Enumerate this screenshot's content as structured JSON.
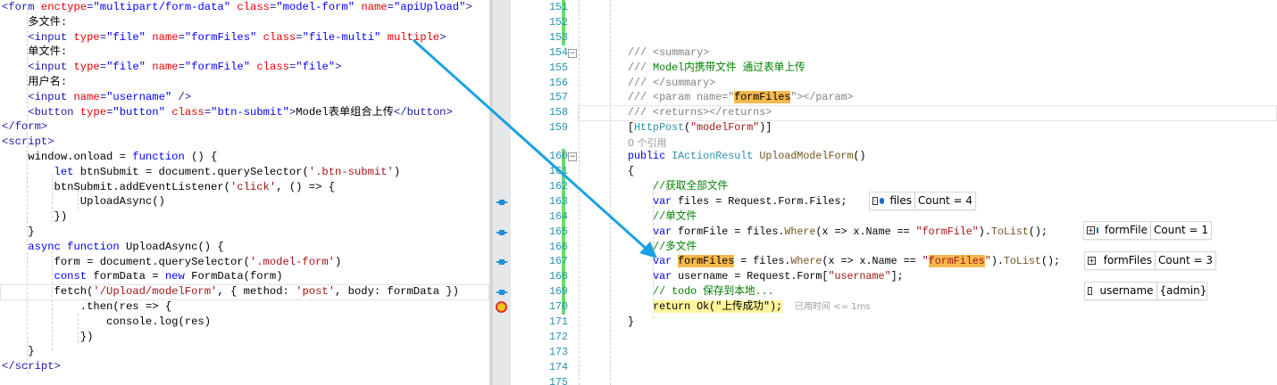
{
  "left_editor": {
    "lines": [
      [
        [
          "t",
          "<form"
        ],
        [
          "p",
          " "
        ],
        [
          "a",
          "enctype"
        ],
        [
          "t",
          "="
        ],
        [
          "v",
          "\"multipart/form-data\""
        ],
        [
          "p",
          " "
        ],
        [
          "a",
          "class"
        ],
        [
          "t",
          "="
        ],
        [
          "v",
          "\"model-form\""
        ],
        [
          "p",
          " "
        ],
        [
          "a",
          "name"
        ],
        [
          "t",
          "="
        ],
        [
          "v",
          "\"apiUpload\""
        ],
        [
          "t",
          ">"
        ]
      ],
      [
        [
          "p",
          "    多文件:"
        ]
      ],
      [
        [
          "p",
          "    "
        ],
        [
          "t",
          "<input"
        ],
        [
          "p",
          " "
        ],
        [
          "a",
          "type"
        ],
        [
          "t",
          "="
        ],
        [
          "v",
          "\"file\""
        ],
        [
          "p",
          " "
        ],
        [
          "a",
          "name"
        ],
        [
          "t",
          "="
        ],
        [
          "v",
          "\"formFiles\""
        ],
        [
          "p",
          " "
        ],
        [
          "a",
          "class"
        ],
        [
          "t",
          "="
        ],
        [
          "v",
          "\"file-multi\""
        ],
        [
          "p",
          " "
        ],
        [
          "a",
          "multiple"
        ],
        [
          "t",
          ">"
        ]
      ],
      [
        [
          "p",
          "    单文件:"
        ]
      ],
      [
        [
          "p",
          "    "
        ],
        [
          "t",
          "<input"
        ],
        [
          "p",
          " "
        ],
        [
          "a",
          "type"
        ],
        [
          "t",
          "="
        ],
        [
          "v",
          "\"file\""
        ],
        [
          "p",
          " "
        ],
        [
          "a",
          "name"
        ],
        [
          "t",
          "="
        ],
        [
          "v",
          "\"formFile\""
        ],
        [
          "p",
          " "
        ],
        [
          "a",
          "class"
        ],
        [
          "t",
          "="
        ],
        [
          "v",
          "\"file\""
        ],
        [
          "t",
          ">"
        ]
      ],
      [
        [
          "p",
          "    用户名:"
        ]
      ],
      [
        [
          "p",
          "    "
        ],
        [
          "t",
          "<input"
        ],
        [
          "p",
          " "
        ],
        [
          "a",
          "name"
        ],
        [
          "t",
          "="
        ],
        [
          "v",
          "\"username\""
        ],
        [
          "p",
          " "
        ],
        [
          "t",
          "/>"
        ]
      ],
      [
        [
          "p",
          "    "
        ],
        [
          "t",
          "<button"
        ],
        [
          "p",
          " "
        ],
        [
          "a",
          "type"
        ],
        [
          "t",
          "="
        ],
        [
          "v",
          "\"button\""
        ],
        [
          "p",
          " "
        ],
        [
          "a",
          "class"
        ],
        [
          "t",
          "="
        ],
        [
          "v",
          "\"btn-submit\""
        ],
        [
          "t",
          ">"
        ],
        [
          "p",
          "Model表单组合上传"
        ],
        [
          "t",
          "</button>"
        ]
      ],
      [
        [
          "t",
          "</form>"
        ]
      ],
      [
        [
          "t",
          "<script>"
        ]
      ],
      [
        [
          "p",
          "    window.onload = "
        ],
        [
          "k",
          "function"
        ],
        [
          "p",
          " () {"
        ]
      ],
      [
        [
          "p",
          "        "
        ],
        [
          "k",
          "let"
        ],
        [
          "p",
          " btnSubmit = document.querySelector("
        ],
        [
          "s",
          "'.btn-submit'"
        ],
        [
          "p",
          ")"
        ]
      ],
      [
        [
          "p",
          "        btnSubmit.addEventListener("
        ],
        [
          "s",
          "'click'"
        ],
        [
          "p",
          ", () => {"
        ]
      ],
      [
        [
          "p",
          "            UploadAsync()"
        ]
      ],
      [
        [
          "p",
          "        })"
        ]
      ],
      [
        [
          "p",
          "    }"
        ]
      ],
      [
        [
          "p",
          "    "
        ],
        [
          "k",
          "async"
        ],
        [
          "p",
          " "
        ],
        [
          "k",
          "function"
        ],
        [
          "p",
          " UploadAsync() {"
        ]
      ],
      [
        [
          "p",
          "        form = document.querySelector("
        ],
        [
          "s",
          "'.model-form'"
        ],
        [
          "p",
          ")"
        ]
      ],
      [
        [
          "p",
          "        "
        ],
        [
          "k",
          "const"
        ],
        [
          "p",
          " formData = "
        ],
        [
          "k",
          "new"
        ],
        [
          "p",
          " FormData(form)"
        ]
      ],
      [
        [
          "p",
          "        fetch("
        ],
        [
          "s",
          "'/Upload/modelForm'"
        ],
        [
          "p",
          ", { method: "
        ],
        [
          "s",
          "'post'"
        ],
        [
          "p",
          ", body: formData })"
        ]
      ],
      [
        [
          "p",
          "            .then(res => {"
        ]
      ],
      [
        [
          "p",
          "                console.log(res)"
        ]
      ],
      [
        [
          "p",
          "            })"
        ]
      ],
      [
        [
          "p",
          "    }"
        ]
      ],
      [
        [
          "t",
          "</script>"
        ]
      ]
    ]
  },
  "right_editor": {
    "code_lens": "0 个引用",
    "lines": [
      {
        "n": "151",
        "tokens": []
      },
      {
        "n": "152",
        "tokens": []
      },
      {
        "n": "153",
        "tokens": []
      },
      {
        "n": "154",
        "tokens": [
          [
            "d",
            "/// <summary>"
          ]
        ]
      },
      {
        "n": "155",
        "tokens": [
          [
            "d",
            "/// "
          ],
          [
            "g",
            "Model内携带文件 通过表单上传"
          ]
        ]
      },
      {
        "n": "156",
        "tokens": [
          [
            "d",
            "/// </summary>"
          ]
        ]
      },
      {
        "n": "157",
        "tokens": [
          [
            "d",
            "/// <param name=\""
          ],
          [
            "hl",
            "formFiles"
          ],
          [
            "d",
            "\"></param>"
          ]
        ]
      },
      {
        "n": "158",
        "tokens": [
          [
            "d",
            "/// <returns></returns>"
          ]
        ]
      },
      {
        "n": "159",
        "tokens": [
          [
            "p",
            "["
          ],
          [
            "ty",
            "HttpPost"
          ],
          [
            "p",
            "("
          ],
          [
            "s",
            "\"modelForm\""
          ],
          [
            "p",
            ")]"
          ]
        ]
      },
      {
        "n": "160",
        "tokens": [
          [
            "k",
            "public"
          ],
          [
            "p",
            " "
          ],
          [
            "ty",
            "IActionResult"
          ],
          [
            "p",
            " "
          ],
          [
            "m",
            "UploadModelForm"
          ],
          [
            "p",
            "()"
          ]
        ]
      },
      {
        "n": "161",
        "tokens": [
          [
            "p",
            "{"
          ]
        ]
      },
      {
        "n": "162",
        "tokens": [
          [
            "p",
            "    "
          ],
          [
            "g",
            "//获取全部文件"
          ]
        ]
      },
      {
        "n": "163",
        "tokens": [
          [
            "p",
            "    "
          ],
          [
            "k",
            "var"
          ],
          [
            "p",
            " files = Request.Form.Files;"
          ]
        ]
      },
      {
        "n": "164",
        "tokens": [
          [
            "p",
            "    "
          ],
          [
            "g",
            "//单文件"
          ]
        ]
      },
      {
        "n": "165",
        "tokens": [
          [
            "p",
            "    "
          ],
          [
            "k",
            "var"
          ],
          [
            "p",
            " formFile = files."
          ],
          [
            "m",
            "Where"
          ],
          [
            "p",
            "(x => x.Name == "
          ],
          [
            "s",
            "\"formFile\""
          ],
          [
            "p",
            ")."
          ],
          [
            "m",
            "ToList"
          ],
          [
            "p",
            "();"
          ]
        ]
      },
      {
        "n": "166",
        "tokens": [
          [
            "p",
            "    "
          ],
          [
            "g",
            "//多文件"
          ]
        ]
      },
      {
        "n": "167",
        "tokens": [
          [
            "p",
            "    "
          ],
          [
            "k",
            "var"
          ],
          [
            "p",
            " "
          ],
          [
            "hl",
            "formFiles"
          ],
          [
            "p",
            " = files."
          ],
          [
            "m",
            "Where"
          ],
          [
            "p",
            "(x => x.Name == "
          ],
          [
            "s",
            "\""
          ],
          [
            "hls",
            "formFiles"
          ],
          [
            "s",
            "\""
          ],
          [
            "p",
            ")."
          ],
          [
            "m",
            "ToList"
          ],
          [
            "p",
            "();"
          ]
        ]
      },
      {
        "n": "168",
        "tokens": [
          [
            "p",
            "    "
          ],
          [
            "k",
            "var"
          ],
          [
            "p",
            " username = Request.Form["
          ],
          [
            "s",
            "\"username\""
          ],
          [
            "p",
            "];"
          ]
        ]
      },
      {
        "n": "169",
        "tokens": [
          [
            "p",
            "    "
          ],
          [
            "g",
            "// todo 保存到本地..."
          ]
        ]
      },
      {
        "n": "170",
        "tokens": [
          [
            "p",
            "    "
          ],
          [
            "ret",
            "return Ok(\"上传成功\");"
          ],
          [
            "p",
            "  "
          ],
          [
            "time",
            "已用时间 <= 1ms"
          ]
        ]
      },
      {
        "n": "171",
        "tokens": [
          [
            "p",
            "}"
          ]
        ]
      },
      {
        "n": "172",
        "tokens": []
      },
      {
        "n": "173",
        "tokens": []
      },
      {
        "n": "174",
        "tokens": []
      },
      {
        "n": "175",
        "tokens": []
      }
    ]
  },
  "datatips": [
    {
      "name": "files",
      "value": "Count = 4",
      "expand": "collapsed-box"
    },
    {
      "name": "formFile",
      "value": "Count = 1",
      "expand": "plus"
    },
    {
      "name": "formFiles",
      "value": "Count = 3",
      "expand": "plus"
    },
    {
      "name": "username",
      "value": "{admin}",
      "expand": "collapsed-box"
    }
  ],
  "icons": {
    "tracepoint": "tracepoint-icon",
    "instruction_pointer": "current-statement-icon",
    "arrow": "annotation-arrow"
  },
  "colors": {
    "arrow": "#1ba1e2",
    "highlight": "#f5b94f",
    "change_bar": "#6fd96f"
  }
}
